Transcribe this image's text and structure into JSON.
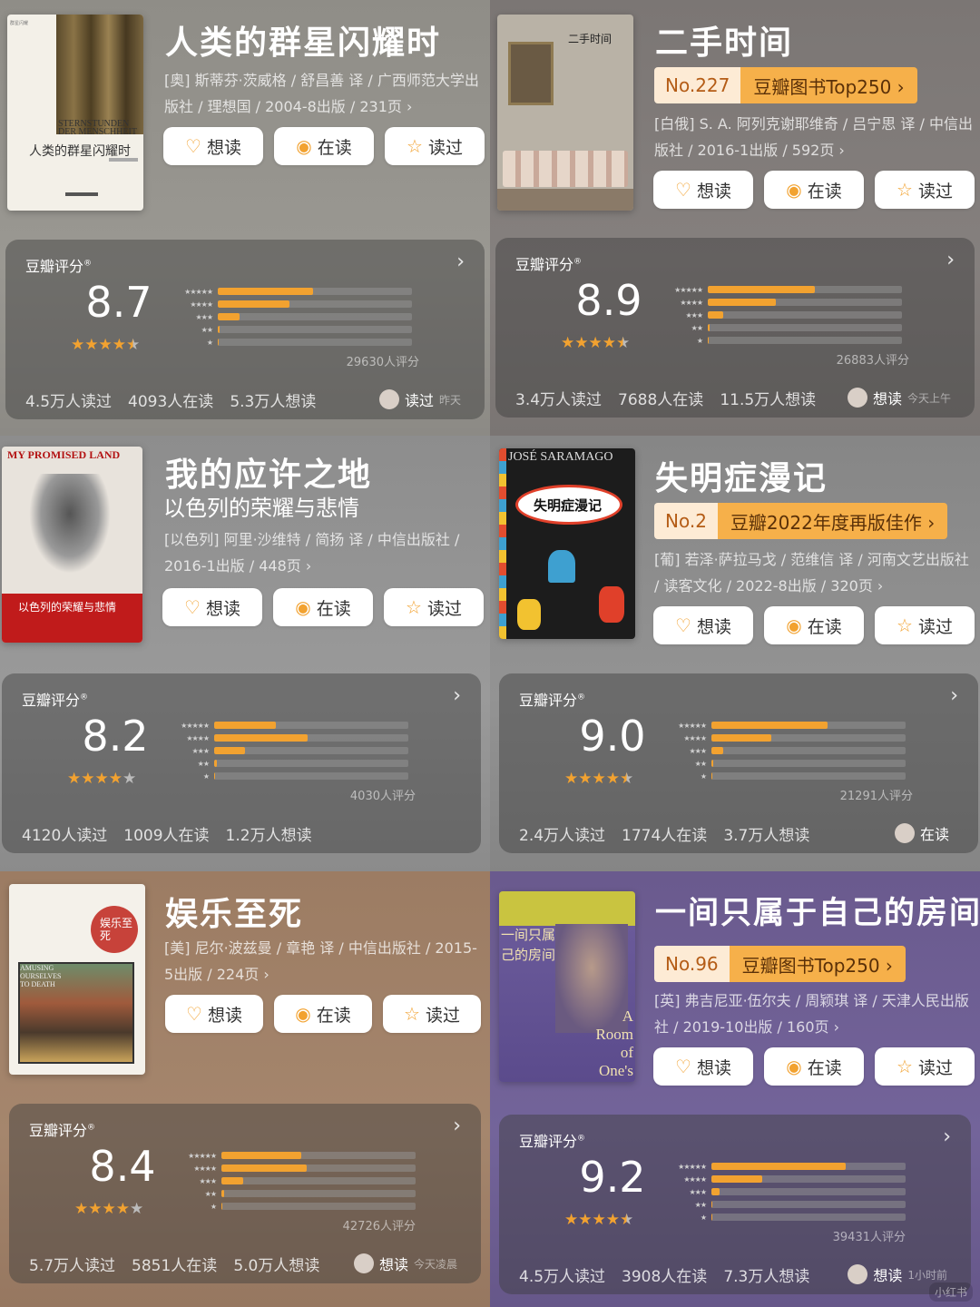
{
  "books": [
    {
      "title": "人类的群星闪耀时",
      "subtitle": "",
      "meta": "[奥] 斯蒂芬·茨威格 / 舒昌善 译 / 广西师范大学出版社 / 理想国 / 2004-8出版 / 231页 ›",
      "cover_text": "人类的群星闪耀时",
      "cover_en": "STERNSTUNDEN DER MENSCHHEIT",
      "buttons": [
        "想读",
        "在读",
        "读过"
      ],
      "rating": {
        "label": "豆瓣评分",
        "score": "8.7",
        "stars": 4.5,
        "count": "29630人评分",
        "dist": [
          0.49,
          0.37,
          0.11,
          0.01,
          0.005
        ]
      },
      "stats": [
        "4.5万人读过",
        "4093人在读",
        "5.3万人想读"
      ],
      "user_action": "读过",
      "user_time": "昨天"
    },
    {
      "title": "二手时间",
      "subtitle": "",
      "rank_no": "No.227",
      "rank_label": "豆瓣图书Top250 ›",
      "meta": "[白俄] S. A. 阿列克谢耶维奇 / 吕宁思 译 / 中信出版社 / 2016-1出版 / 592页 ›",
      "cover_text": "二手时间",
      "buttons": [
        "想读",
        "在读",
        "读过"
      ],
      "rating": {
        "label": "豆瓣评分",
        "score": "8.9",
        "stars": 4.5,
        "count": "26883人评分",
        "dist": [
          0.55,
          0.35,
          0.08,
          0.01,
          0.005
        ]
      },
      "stats": [
        "3.4万人读过",
        "7688人在读",
        "11.5万人想读"
      ],
      "user_action": "想读",
      "user_time": "今天上午"
    },
    {
      "title": "我的应许之地",
      "subtitle": "以色列的荣耀与悲情",
      "meta": "[以色列] 阿里·沙维特 / 简扬 译 / 中信出版社 / 2016-1出版 / 448页 ›",
      "cover_text": "以色列的荣耀与悲情",
      "cover_en": "MY PROMISED LAND",
      "buttons": [
        "想读",
        "在读",
        "读过"
      ],
      "rating": {
        "label": "豆瓣评分",
        "score": "8.2",
        "stars": 4,
        "count": "4030人评分",
        "dist": [
          0.32,
          0.48,
          0.16,
          0.015,
          0.005
        ]
      },
      "stats": [
        "4120人读过",
        "1009人在读",
        "1.2万人想读"
      ]
    },
    {
      "title": "失明症漫记",
      "subtitle": "",
      "rank_no": "No.2",
      "rank_label": "豆瓣2022年度再版佳作 ›",
      "meta": "[葡] 若泽·萨拉马戈 / 范维信 译 / 河南文艺出版社 / 读客文化 / 2022-8出版 / 320页 ›",
      "cover_text": "失明症漫记",
      "cover_en": "JOSÉ SARAMAGO",
      "buttons": [
        "想读",
        "在读",
        "读过"
      ],
      "rating": {
        "label": "豆瓣评分",
        "score": "9.0",
        "stars": 4.5,
        "count": "21291人评分",
        "dist": [
          0.6,
          0.31,
          0.06,
          0.01,
          0.005
        ]
      },
      "stats": [
        "2.4万人读过",
        "1774人在读",
        "3.7万人想读"
      ],
      "user_action": "在读",
      "user_time": ""
    },
    {
      "title": "娱乐至死",
      "subtitle": "",
      "meta": "[美] 尼尔·波兹曼 / 章艳 译 / 中信出版社 / 2015-5出版 / 224页 ›",
      "cover_text": "娱乐至死",
      "cover_en": "AMUSING OURSELVES TO DEATH",
      "buttons": [
        "想读",
        "在读",
        "读过"
      ],
      "rating": {
        "label": "豆瓣评分",
        "score": "8.4",
        "stars": 4,
        "count": "42726人评分",
        "dist": [
          0.41,
          0.44,
          0.11,
          0.015,
          0.005
        ]
      },
      "stats": [
        "5.7万人读过",
        "5851人在读",
        "5.0万人想读"
      ],
      "user_action": "想读",
      "user_time": "今天凌晨"
    },
    {
      "title": "一间只属于自己的房间",
      "subtitle": "",
      "rank_no": "No.96",
      "rank_label": "豆瓣图书Top250 ›",
      "meta": "[英] 弗吉尼亚·伍尔夫 / 周颖琪 译 / 天津人民出版社 / 2019-10出版 / 160页 ›",
      "cover_text": "一间只属于自己的房间",
      "cover_en": "A Room of One's Own",
      "buttons": [
        "想读",
        "在读",
        "读过"
      ],
      "rating": {
        "label": "豆瓣评分",
        "score": "9.2",
        "stars": 4.5,
        "count": "39431人评分",
        "dist": [
          0.69,
          0.26,
          0.04,
          0.005,
          0.003
        ]
      },
      "stats": [
        "4.5万人读过",
        "3908人在读",
        "7.3万人想读"
      ],
      "user_action": "想读",
      "user_time": "1小时前"
    }
  ],
  "watermark": "小红书",
  "colors": {
    "accent": "#f2a230",
    "rank_bg": "#f6b04a",
    "rank_no_bg": "#fdebd5"
  }
}
